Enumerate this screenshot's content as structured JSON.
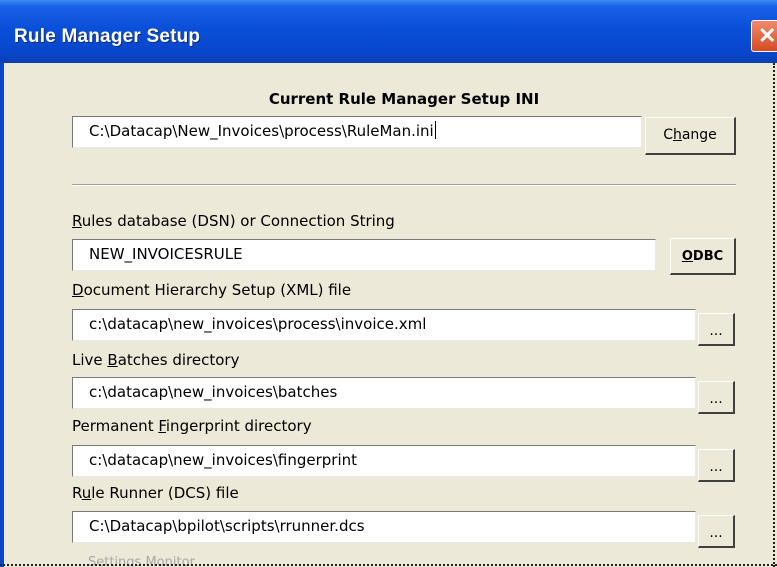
{
  "window": {
    "title": "Rule Manager Setup",
    "close_glyph": "✕"
  },
  "ini": {
    "heading": "Current Rule Manager Setup INI",
    "value": "C:\\Datacap\\New_Invoices\\process\\RuleMan.ini",
    "change_button": {
      "pre": "C",
      "accel": "h",
      "post": "ange"
    }
  },
  "rules_db": {
    "label": {
      "pre": "",
      "accel": "R",
      "post": "ules database (DSN) or Connection String"
    },
    "value": "NEW_INVOICESRULE",
    "odbc_button": {
      "pre": "",
      "accel": "O",
      "post": "DBC"
    }
  },
  "doc_hierarchy": {
    "label": {
      "pre": "",
      "accel": "D",
      "post": "ocument Hierarchy Setup (XML) file"
    },
    "value": "c:\\datacap\\new_invoices\\process\\invoice.xml",
    "browse_button": "..."
  },
  "live_batches": {
    "label": {
      "pre": "Live ",
      "accel": "B",
      "post": "atches directory"
    },
    "value": "c:\\datacap\\new_invoices\\batches",
    "browse_button": "..."
  },
  "fingerprint": {
    "label": {
      "pre": "Permanent ",
      "accel": "F",
      "post": "ingerprint directory"
    },
    "value": "c:\\datacap\\new_invoices\\fingerprint",
    "browse_button": "..."
  },
  "rule_runner": {
    "label": {
      "pre": "R",
      "accel": "u",
      "post": "le Runner (DCS) file"
    },
    "value": "C:\\Datacap\\bpilot\\scripts\\rrunner.dcs",
    "browse_button": "..."
  },
  "settings_monitor": {
    "label": "Settings Monitor"
  },
  "colors": {
    "titlebar": "#0a4fd9",
    "dialog_bg": "#ece9d8",
    "close": "#d84a20"
  }
}
